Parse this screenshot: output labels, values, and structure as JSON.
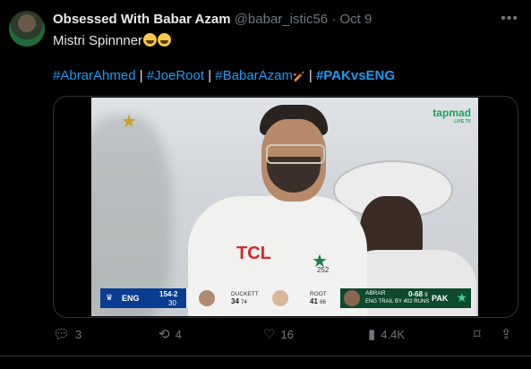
{
  "post": {
    "display_name": "Obsessed With Babar Azam",
    "handle": "@babar_istic56",
    "separator": "·",
    "date": "Oct 9",
    "text": "Mistri Spinnner",
    "hashtags": [
      "#AbrarAhmed",
      "#JoeRoot",
      "#BabarAzam",
      "#PAKvsENG"
    ],
    "tag_sep": "|"
  },
  "video": {
    "broadcaster": "tapmad",
    "broadcaster_sub": "LIVE TV",
    "jersey_sponsor": "TCL",
    "jersey_number": "252",
    "scoreboard": {
      "batting_team": "ENG",
      "score": "154-2",
      "overs": "30",
      "batter1_name": "DUCKETT",
      "batter1_runs": "34",
      "batter1_balls": "74",
      "batter2_name": "ROOT",
      "batter2_runs": "41",
      "batter2_balls": "66",
      "bowler_name": "ABRAR",
      "bowler_figures": "0-68",
      "bowler_overs": "9",
      "trail_text": "ENG TRAIL BY 402 RUNS",
      "bowling_team": "PAK"
    }
  },
  "actions": {
    "replies": "3",
    "reposts": "4",
    "likes": "16",
    "views": "4.4K"
  },
  "colors": {
    "background": "#000000",
    "link": "#1d9bf0",
    "muted": "#71767b"
  }
}
